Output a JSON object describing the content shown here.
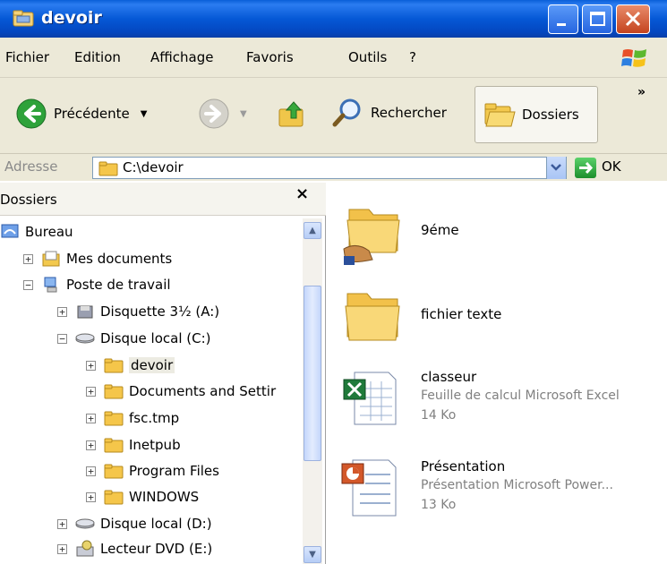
{
  "window": {
    "title": "devoir"
  },
  "menu": [
    "Fichier",
    "Edition",
    "Affichage",
    "Favoris",
    "Outils",
    "?"
  ],
  "toolbar": {
    "back_label": "Précédente",
    "search_label": "Rechercher",
    "folders_label": "Dossiers",
    "more": "»"
  },
  "address": {
    "label": "Adresse",
    "value": "C:\\devoir",
    "go_label": "OK"
  },
  "folders_pane": {
    "title": "Dossiers",
    "close": "×",
    "tree": [
      {
        "label": "Bureau",
        "icon": "desktop-icon"
      },
      {
        "label": "Mes documents",
        "icon": "my-documents-icon",
        "expander": "+"
      },
      {
        "label": "Poste de travail",
        "icon": "my-computer-icon",
        "expander": "−"
      },
      {
        "label": "Disquette 3½ (A:)",
        "icon": "floppy-drive-icon",
        "expander": "+"
      },
      {
        "label": "Disque local (C:)",
        "icon": "hard-drive-icon",
        "expander": "−"
      },
      {
        "label": "devoir",
        "icon": "folder-icon",
        "expander": "+"
      },
      {
        "label": "Documents and Settir",
        "icon": "folder-icon",
        "expander": "+"
      },
      {
        "label": "fsc.tmp",
        "icon": "folder-icon",
        "expander": "+"
      },
      {
        "label": "Inetpub",
        "icon": "folder-icon",
        "expander": "+"
      },
      {
        "label": "Program Files",
        "icon": "folder-icon",
        "expander": "+"
      },
      {
        "label": "WINDOWS",
        "icon": "folder-icon",
        "expander": "+"
      },
      {
        "label": "Disque local (D:)",
        "icon": "hard-drive-icon",
        "expander": "+"
      },
      {
        "label": "Lecteur DVD (E:)",
        "icon": "dvd-drive-icon",
        "expander": "+"
      }
    ]
  },
  "files": [
    {
      "name": "9éme",
      "icon": "shared-folder-icon"
    },
    {
      "name": "fichier texte",
      "icon": "folder-icon"
    },
    {
      "name": "classeur",
      "type": "Feuille de calcul Microsoft Excel",
      "size": "14 Ko",
      "icon": "excel-file-icon"
    },
    {
      "name": "Présentation",
      "type": "Présentation Microsoft Power...",
      "size": "13 Ko",
      "icon": "powerpoint-file-icon"
    }
  ],
  "colors": {
    "titlebar": "#0558d6",
    "chrome": "#ece9d8",
    "folder": "#f5c64a"
  }
}
